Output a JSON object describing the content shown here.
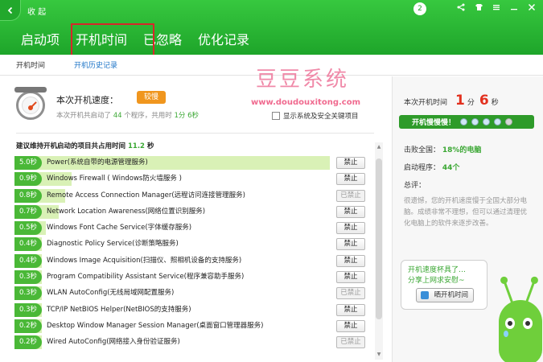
{
  "header": {
    "collapse_label": "收 起",
    "tabs": [
      {
        "label": "启动项"
      },
      {
        "label": "开机时间"
      },
      {
        "label": "已忽略"
      },
      {
        "label": "优化记录"
      }
    ],
    "badge": "2"
  },
  "subnav": {
    "items": [
      {
        "label": "开机时间"
      },
      {
        "label": "开机历史记录"
      }
    ]
  },
  "watermark": {
    "title": "豆豆系统",
    "url": "www.doudouxitong.com"
  },
  "speed": {
    "title": "本次开机速度：",
    "tag": "较慢",
    "desc_prefix": "本次开机共启动了",
    "programs": "44",
    "desc_mid": "个程序，共用时",
    "time": "1分 6秒",
    "show_system_label": "显示系统及安全关键项目"
  },
  "summary": {
    "prefix": "建议维持开机启动的项目共占用时间",
    "value": "11.2",
    "unit": "秒"
  },
  "items": [
    {
      "time": "5.0秒",
      "name": "Power(系统自带的电源管理服务)",
      "action": "禁止",
      "disabled": false,
      "bar": 1.0
    },
    {
      "time": "0.9秒",
      "name": "Windows Firewall ( Windows防火墙服务 )",
      "action": "禁止",
      "disabled": false,
      "bar": 0.18
    },
    {
      "time": "0.8秒",
      "name": "Remote Access Connection Manager(远程访问连接管理服务)",
      "action": "已禁止",
      "disabled": true,
      "bar": 0.16
    },
    {
      "time": "0.7秒",
      "name": "Network Location Awareness(网络位置识别服务)",
      "action": "禁止",
      "disabled": false,
      "bar": 0.14
    },
    {
      "time": "0.5秒",
      "name": "Windows Font Cache Service(字体缓存服务)",
      "action": "禁止",
      "disabled": false,
      "bar": 0.1
    },
    {
      "time": "0.4秒",
      "name": "Diagnostic Policy Service(诊断策略服务)",
      "action": "禁止",
      "disabled": false,
      "bar": 0.08
    },
    {
      "time": "0.4秒",
      "name": "Windows Image Acquisition(扫描仪、照相机设备的支持服务)",
      "action": "禁止",
      "disabled": false,
      "bar": 0.08
    },
    {
      "time": "0.3秒",
      "name": "Program Compatibility Assistant Service(程序兼容助手服务)",
      "action": "禁止",
      "disabled": false,
      "bar": 0.06
    },
    {
      "time": "0.3秒",
      "name": "WLAN AutoConfig(无线局域网配置服务)",
      "action": "已禁止",
      "disabled": true,
      "bar": 0.06
    },
    {
      "time": "0.3秒",
      "name": "TCP/IP NetBIOS Helper(NetBIOS的支持服务)",
      "action": "禁止",
      "disabled": false,
      "bar": 0.06
    },
    {
      "time": "0.2秒",
      "name": "Desktop Window Manager Session Manager(桌面窗口管理器服务)",
      "action": "禁止",
      "disabled": false,
      "bar": 0.04
    },
    {
      "time": "0.2秒",
      "name": "Wired AutoConfig(网络接入身份验证服务)",
      "action": "已禁止",
      "disabled": true,
      "bar": 0.04
    }
  ],
  "side": {
    "boot_label": "本次开机时间",
    "minutes": "1",
    "min_unit": "分",
    "seconds": "6",
    "sec_unit": "秒",
    "slow_label": "开机慢慢慢！",
    "beat_label": "击败全国：",
    "beat_value": "18%的电脑",
    "startup_label": "启动程序：",
    "startup_value": "44个",
    "eval_label": "总评：",
    "eval_text": "很遗憾，您的开机速度慢于全国大部分电脑。成绩非常不理想，但可以通过清理优化电脑上的软件来逐步改善。",
    "bubble_line1": "开机速度杯具了…",
    "bubble_line2": "分享上网求安慰~",
    "share_label": "晒开机时间"
  },
  "colors": {
    "header_green": "#1ea52a",
    "accent_green": "#3aa733",
    "time_red": "#e2301e",
    "tag_orange": "#f0961e",
    "highlight_red": "#d8262a"
  }
}
